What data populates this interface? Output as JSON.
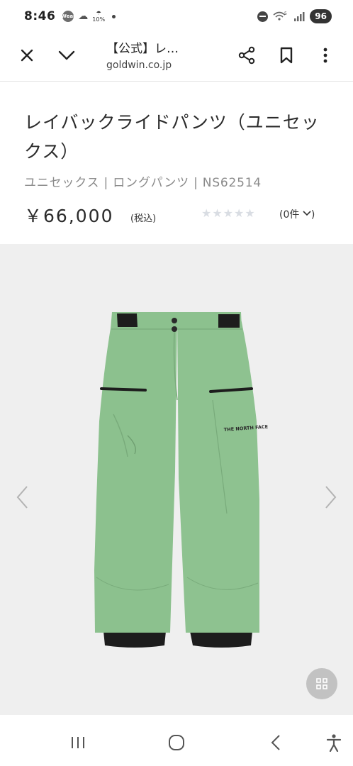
{
  "status_bar": {
    "time": "8:46",
    "wear_label": "Wear",
    "temp": "10%",
    "battery": "96",
    "signal_label": "5"
  },
  "browser": {
    "title": "【公式】レ…",
    "domain": "goldwin.co.jp"
  },
  "product": {
    "title": "レイバックライドパンツ（ユニセックス）",
    "meta": "ユニセックス | ロングパンツ | NS62514",
    "price": "￥66,000",
    "tax_note": "(税込)",
    "rating": 0,
    "review_count": "(0件",
    "logo_text": "THE NORTH FACE",
    "colors": {
      "pants": "#8cc18e",
      "trim": "#1d1d1d",
      "background": "#efefef"
    }
  },
  "icons": [
    "close-icon",
    "chevron-down-icon",
    "share-icon",
    "bookmark-icon",
    "more-vert-icon",
    "chevron-left-icon",
    "chevron-right-icon",
    "grid-icon",
    "recent-apps-icon",
    "home-icon",
    "back-icon",
    "accessibility-icon"
  ]
}
